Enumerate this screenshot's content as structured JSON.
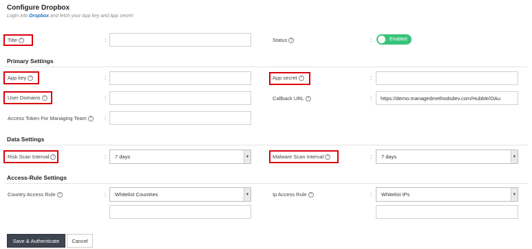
{
  "page": {
    "title": "Configure Dropbox",
    "subtitle_prefix": "Login into ",
    "subtitle_link": "Dropbox",
    "subtitle_suffix": " and fetch your App key and App secret"
  },
  "fields": {
    "title_label": "Title",
    "title_value": "",
    "status_label": "Status",
    "status_toggle": "Enabled"
  },
  "sections": {
    "primary": "Primary Settings",
    "data": "Data Settings",
    "access": "Access-Rule Settings"
  },
  "primary": {
    "app_key_label": "App key",
    "app_key_value": "",
    "app_secret_label": "App secret",
    "app_secret_value": "",
    "user_domains_label": "User Domains",
    "user_domains_value": "",
    "callback_url_label": "Callback URL",
    "callback_url_value": "https://demo.managedmethodsdev.com/Hubble/OAu",
    "access_token_label": "Access Token For Managing Team",
    "access_token_value": ""
  },
  "data_settings": {
    "risk_scan_label": "Risk Scan Interval",
    "risk_scan_value": "7 days",
    "malware_scan_label": "Malware Scan Interval",
    "malware_scan_value": "7 days"
  },
  "access_rules": {
    "country_label": "Country Access Rule",
    "country_value": "Whitelist Countries",
    "country_extra": "",
    "ip_label": "Ip Access Rule",
    "ip_value": "Whitelist IPs",
    "ip_extra": ""
  },
  "buttons": {
    "save": "Save & Authenticate",
    "cancel": "Cancel"
  },
  "colors": {
    "highlight": "#d9000c",
    "toggle_on": "#37c47a",
    "primary_button": "#3d4550",
    "link": "#1a73c8"
  },
  "icons": {
    "help": "question-circle-icon",
    "dropdown": "caret-down-icon"
  }
}
